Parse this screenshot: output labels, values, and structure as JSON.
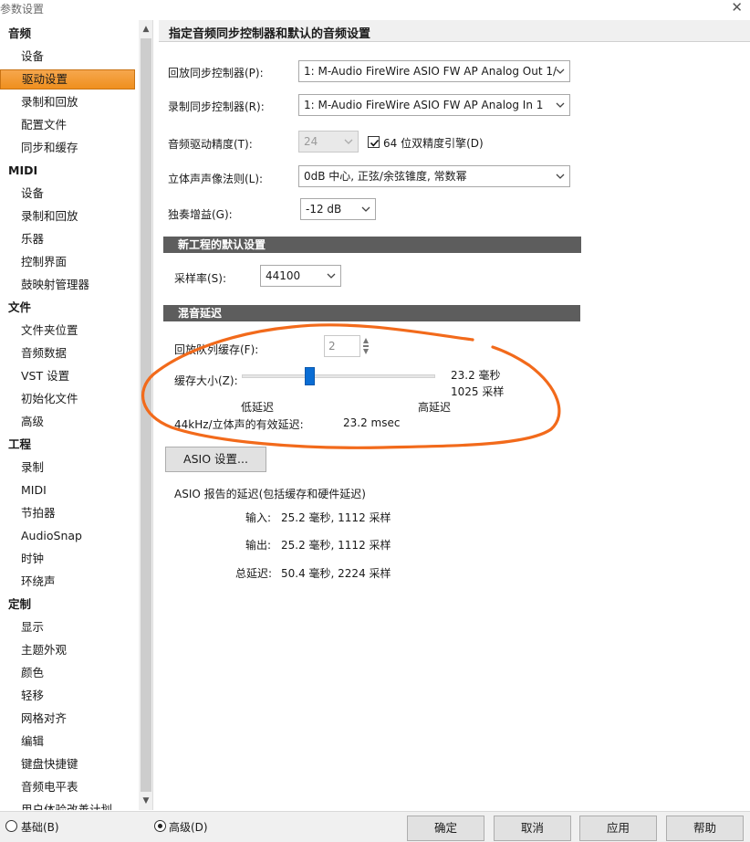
{
  "window": {
    "title": "参数设置"
  },
  "sidebar": {
    "categories": [
      {
        "label": "音频",
        "items": [
          "设备",
          "驱动设置",
          "录制和回放",
          "配置文件",
          "同步和缓存"
        ]
      },
      {
        "label": "MIDI",
        "items": [
          "设备",
          "录制和回放",
          "乐器",
          "控制界面",
          "鼓映射管理器"
        ]
      },
      {
        "label": "文件",
        "items": [
          "文件夹位置",
          "音频数据",
          "VST 设置",
          "初始化文件",
          "高级"
        ]
      },
      {
        "label": "工程",
        "items": [
          "录制",
          "MIDI",
          "节拍器",
          "AudioSnap",
          "时钟",
          "环绕声"
        ]
      },
      {
        "label": "定制",
        "items": [
          "显示",
          "主题外观",
          "颜色",
          "轻移",
          "网格对齐",
          "编辑",
          "键盘快捷键",
          "音频电平表",
          "用户体验改善计划"
        ]
      }
    ],
    "selected": "驱动设置"
  },
  "main": {
    "header": "指定音频同步控制器和默认的音频设置",
    "playback_label": "回放同步控制器(P):",
    "playback_value": "1: M-Audio FireWire ASIO FW AP Analog Out 1/",
    "record_label": "录制同步控制器(R):",
    "record_value": "1: M-Audio FireWire ASIO FW AP Analog In 1",
    "bitdepth_label": "音频驱动精度(T):",
    "bitdepth_value": "24",
    "double_precision_label": "64 位双精度引擎(D)",
    "double_precision_checked": true,
    "panlaw_label": "立体声声像法则(L):",
    "panlaw_value": "0dB 中心, 正弦/余弦锥度, 常数幂",
    "solo_label": "独奏增益(G):",
    "solo_value": "-12 dB",
    "new_project_section": "新工程的默认设置",
    "samplerate_label": "采样率(S):",
    "samplerate_value": "44100",
    "mix_latency_section": "混音延迟",
    "playback_buffer_label": "回放队列缓存(F):",
    "playback_buffer_value": "2",
    "buffer_size_label": "缓存大小(Z):",
    "buffer_ms": "23.2 毫秒",
    "buffer_samples": "1025 采样",
    "buffer_slider_fraction": 0.35,
    "low_latency": "低延迟",
    "high_latency": "高延迟",
    "effective_latency_label": "44kHz/立体声的有效延迟:",
    "effective_latency_value": "23.2 msec",
    "asio_button": "ASIO 设置...",
    "asio_report_label": "ASIO 报告的延迟(包括缓存和硬件延迟)",
    "input_label": "输入:",
    "input_value": "25.2 毫秒, 1112 采样",
    "output_label": "输出:",
    "output_value": "25.2 毫秒, 1112 采样",
    "total_label": "总延迟:",
    "total_value": "50.4 毫秒, 2224 采样"
  },
  "footer": {
    "basic_label": "基础(B)",
    "advanced_label": "高级(D)",
    "mode_selected": "advanced",
    "ok_label": "确定",
    "cancel_label": "取消",
    "apply_label": "应用",
    "help_label": "帮助"
  },
  "colors": {
    "selection": "#f19a33",
    "annotation": "#f26a1b",
    "section_bar": "#5d5d5d",
    "slider_thumb": "#0a6dd4"
  }
}
